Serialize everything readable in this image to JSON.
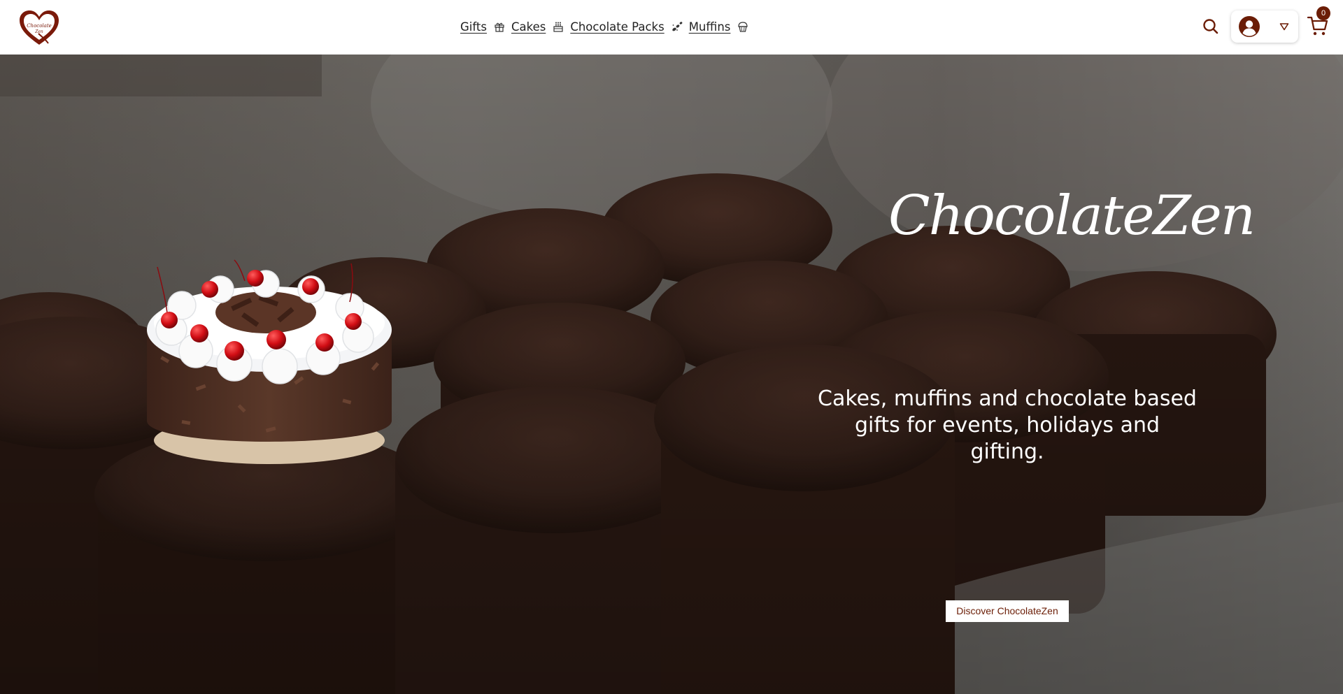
{
  "brand": {
    "logo_text": "Chocolate Zen",
    "hero_title": "ChocolateZen",
    "accent_color": "#6b1d06"
  },
  "nav": {
    "items": [
      {
        "label": "Gifts",
        "icon": "gift-icon"
      },
      {
        "label": "Cakes",
        "icon": "cake-icon"
      },
      {
        "label": "Chocolate Packs",
        "icon": "chocolates-icon"
      },
      {
        "label": "Muffins",
        "icon": "muffin-icon"
      }
    ]
  },
  "header": {
    "search_icon": "search-icon",
    "account_icon": "user-avatar-icon",
    "dropdown_icon": "caret-down-icon",
    "cart_icon": "cart-icon",
    "cart_count": "0"
  },
  "hero": {
    "tagline": "Cakes, muffins and chocolate based gifts for events, holidays and gifting.",
    "cta_label": "Discover ChocolateZen",
    "image": "chocolate-muffins-background",
    "feature_image": "black-forest-cake"
  }
}
